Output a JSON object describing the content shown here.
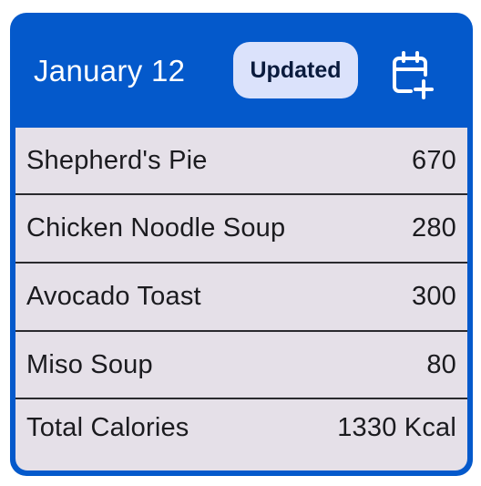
{
  "header": {
    "date": "January 12",
    "badge": "Updated",
    "add_icon": "calendar-add-icon"
  },
  "meals": [
    {
      "name": "Shepherd's Pie",
      "calories": "670"
    },
    {
      "name": "Chicken Noodle Soup",
      "calories": "280"
    },
    {
      "name": "Avocado Toast",
      "calories": "300"
    },
    {
      "name": "Miso Soup",
      "calories": "80"
    }
  ],
  "total": {
    "label": "Total Calories",
    "value": "1330 Kcal"
  },
  "colors": {
    "header_bg": "#0459cb",
    "badge_bg": "#dbe2fb",
    "list_bg": "#e5e0e8"
  }
}
